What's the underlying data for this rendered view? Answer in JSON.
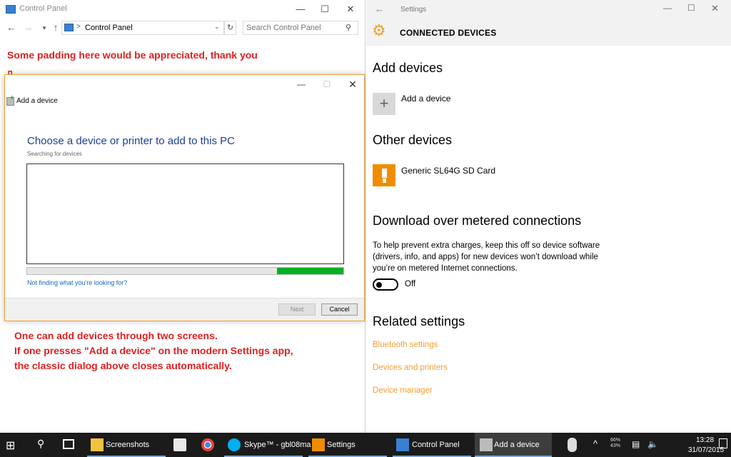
{
  "control_panel": {
    "title": "Control Panel",
    "address_separator": ">",
    "address_path": "Control Panel",
    "search_placeholder": "Search Control Panel",
    "annotation_top": "Some padding here would be appreciated, thank you",
    "annotation_bottom": [
      "One can add devices through two screens.",
      "If one presses \"Add a device\" on the modern Settings app,",
      "the classic dialog above closes automatically."
    ]
  },
  "add_device_dialog": {
    "caption": "Add a device",
    "heading": "Choose a device or printer to add to this PC",
    "status": "Searching for devices",
    "progress_fraction": 0.21,
    "progress_position": "right",
    "help_link": "Not finding what you're looking for?",
    "next_label": "Next",
    "cancel_label": "Cancel"
  },
  "settings": {
    "title": "Settings",
    "page_title": "CONNECTED DEVICES",
    "accent_color": "#f0a030",
    "sections": {
      "add_devices": {
        "heading": "Add devices",
        "add_label": "Add a device"
      },
      "other_devices": {
        "heading": "Other devices",
        "device_name": "Generic SL64G SD Card"
      },
      "metered": {
        "heading": "Download over metered connections",
        "description": "To help prevent extra charges, keep this off so device software (drivers, info, and apps) for new devices won’t download while you’re on metered Internet connections.",
        "toggle_state": "Off"
      },
      "related": {
        "heading": "Related settings",
        "links": [
          "Bluetooth settings",
          "Devices and printers",
          "Device manager"
        ]
      }
    }
  },
  "taskbar": {
    "apps": [
      {
        "label": "Screenshots",
        "icon": "folder-icon"
      },
      {
        "label": "",
        "icon": "store-icon"
      },
      {
        "label": "",
        "icon": "chrome-icon"
      },
      {
        "label": "Skype™ - gbl08ma",
        "icon": "skype-icon"
      },
      {
        "label": "Settings",
        "icon": "settings-icon"
      },
      {
        "label": "Control Panel",
        "icon": "control-panel-icon"
      },
      {
        "label": "Add a device",
        "icon": "add-device-icon"
      }
    ],
    "tray_stat": "66%\n43%",
    "time": "13:28",
    "date": "31/07/2015"
  }
}
